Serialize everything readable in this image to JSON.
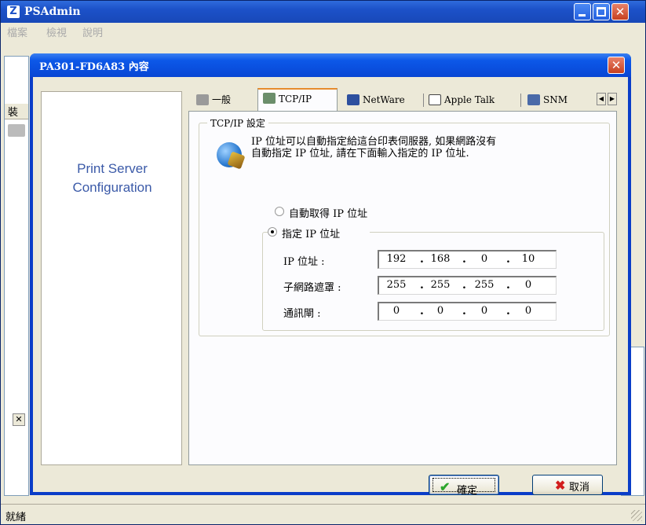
{
  "main_window": {
    "title": "PSAdmin",
    "app_icon_glyph": "Z",
    "menu": [
      "檔案",
      "檢視",
      "說明"
    ],
    "left_header": "裝",
    "status": "就緒"
  },
  "dialog": {
    "title": "PA301-FD6A83 內容",
    "side_panel": {
      "line1": "Print Server",
      "line2": "Configuration"
    },
    "tabs": [
      {
        "label": "一般",
        "icon": "printer-icon"
      },
      {
        "label": "TCP/IP",
        "icon": "network-tool-icon",
        "active": true
      },
      {
        "label": "NetWare",
        "icon": "monitor-icon"
      },
      {
        "label": "Apple Talk",
        "icon": "window-icon"
      },
      {
        "label": "SNM",
        "icon": "computers-icon"
      }
    ],
    "group_title": "TCP/IP 設定",
    "description_line1": "IP 位址可以自動指定給這台印表伺服器, 如果網路沒有",
    "description_line2": "自動指定 IP 位址, 請在下面輸入指定的 IP 位址.",
    "radio_auto": {
      "label": "自動取得 IP 位址",
      "selected": false
    },
    "radio_static": {
      "label": "指定 IP 位址",
      "selected": true
    },
    "fields": {
      "ip": {
        "label": "IP 位址 :",
        "octets": [
          "192",
          "168",
          "0",
          "10"
        ]
      },
      "mask": {
        "label": "子網路遮罩 :",
        "octets": [
          "255",
          "255",
          "255",
          "0"
        ]
      },
      "gateway": {
        "label": "通訊閘 :",
        "octets": [
          "0",
          "0",
          "0",
          "0"
        ]
      }
    },
    "buttons": {
      "ok": "確定",
      "cancel": "取消"
    }
  },
  "colors": {
    "titlebar_blue": "#0c58e8",
    "close_red": "#c6401f",
    "active_tab_accent": "#e68b2c",
    "side_text": "#3b5aa8"
  }
}
